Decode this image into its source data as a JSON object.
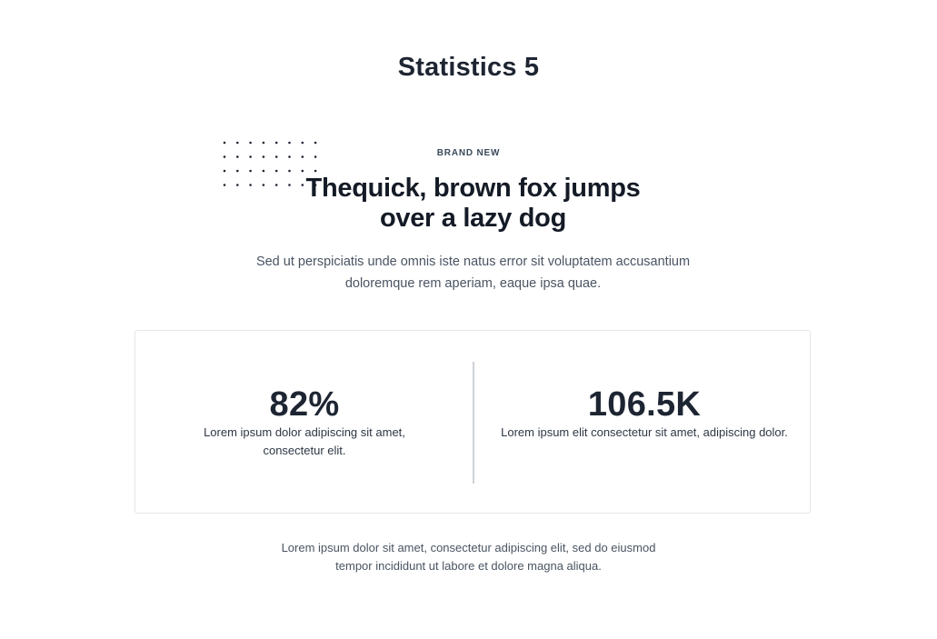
{
  "page": {
    "title": "Statistics 5"
  },
  "hero": {
    "eyebrow": "BRAND NEW",
    "headline": "Thequick, brown fox jumps over a lazy dog",
    "intro": "Sed ut perspiciatis unde omnis iste natus error sit voluptatem accusantium doloremque rem aperiam, eaque ipsa quae."
  },
  "stats": [
    {
      "value": "82%",
      "description": "Lorem ipsum dolor adipiscing sit amet, consectetur elit."
    },
    {
      "value": "106.5K",
      "description": "Lorem ipsum elit consectetur sit amet, adipiscing dolor."
    }
  ],
  "footnote": "Lorem ipsum dolor sit amet, consectetur adipiscing elit, sed do eiusmod tempor incididunt ut labore et dolore magna aliqua.",
  "colors": {
    "heading": "#1e2532",
    "body_text": "#4a5462",
    "card_border": "#e4e6ea",
    "divider": "#cfd2d6",
    "dot_pattern": "#1e2532"
  },
  "icons": {
    "decoration": "dot-grid-pattern"
  }
}
